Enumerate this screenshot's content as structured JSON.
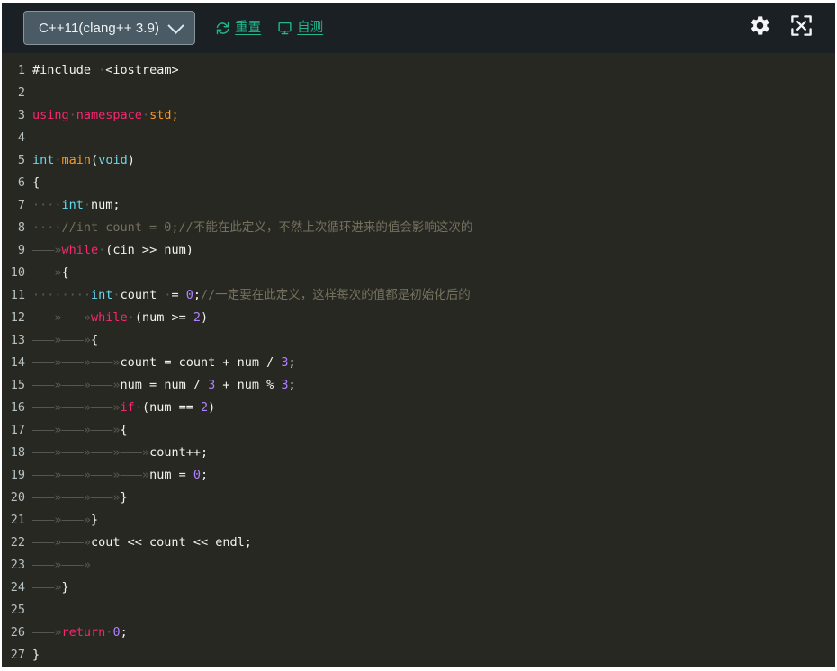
{
  "toolbar": {
    "language_selector": {
      "value": "C++11(clang++ 3.9)",
      "chevron_icon": "chevron-down-icon"
    },
    "reset_button": {
      "label": "重置",
      "icon": "refresh-icon"
    },
    "selftest_button": {
      "label": "自测",
      "icon": "monitor-icon"
    },
    "settings_button": {
      "icon": "gear-icon"
    },
    "fullscreen_button": {
      "icon": "expand-icon"
    }
  },
  "colors": {
    "toolbar_bg": "#1b2024",
    "editor_bg": "#272822",
    "accent_teal": "#22b58c",
    "select_bg": "#4a5b66",
    "gutter_text": "#b7c2c4",
    "keyword": "#f92672",
    "type": "#66d9ef",
    "function": "#fd971f",
    "number": "#ae81ff",
    "comment": "#75715e",
    "plain": "#f2f2ee",
    "whitespace_marker": "#5a5a50"
  },
  "editor": {
    "language": "cpp",
    "total_lines": 27,
    "lines": [
      {
        "n": 1,
        "tokens": [
          {
            "t": "plain",
            "v": "#include "
          },
          {
            "t": "ws",
            "v": "·"
          },
          {
            "t": "plain",
            "v": "<iostream>"
          }
        ]
      },
      {
        "n": 2,
        "tokens": []
      },
      {
        "n": 3,
        "tokens": [
          {
            "t": "kw",
            "v": "using"
          },
          {
            "t": "ws",
            "v": "·"
          },
          {
            "t": "kw",
            "v": "namespace"
          },
          {
            "t": "ws",
            "v": "·"
          },
          {
            "t": "fn",
            "v": "std"
          },
          {
            "t": "fn",
            "v": ";"
          }
        ]
      },
      {
        "n": 4,
        "tokens": []
      },
      {
        "n": 5,
        "tokens": [
          {
            "t": "type",
            "v": "int"
          },
          {
            "t": "ws",
            "v": "·"
          },
          {
            "t": "fn",
            "v": "main"
          },
          {
            "t": "plain",
            "v": "("
          },
          {
            "t": "type",
            "v": "void"
          },
          {
            "t": "plain",
            "v": ")"
          }
        ]
      },
      {
        "n": 6,
        "tokens": [
          {
            "t": "plain",
            "v": "{"
          }
        ]
      },
      {
        "n": 7,
        "tokens": [
          {
            "t": "ws",
            "v": "····"
          },
          {
            "t": "type",
            "v": "int"
          },
          {
            "t": "ws",
            "v": "·"
          },
          {
            "t": "plain",
            "v": "num;"
          }
        ]
      },
      {
        "n": 8,
        "tokens": [
          {
            "t": "ws",
            "v": "····"
          },
          {
            "t": "com",
            "v": "//int count = 0;//不能在此定义，不然上次循环进来的值会影响这次的"
          }
        ]
      },
      {
        "n": 9,
        "tokens": [
          {
            "t": "tab",
            "v": "1"
          },
          {
            "t": "kw",
            "v": "while"
          },
          {
            "t": "ws",
            "v": "·"
          },
          {
            "t": "plain",
            "v": "(cin >> num)"
          }
        ]
      },
      {
        "n": 10,
        "tokens": [
          {
            "t": "tab",
            "v": "1"
          },
          {
            "t": "plain",
            "v": "{"
          }
        ]
      },
      {
        "n": 11,
        "tokens": [
          {
            "t": "ws",
            "v": "········"
          },
          {
            "t": "type",
            "v": "int"
          },
          {
            "t": "ws",
            "v": "·"
          },
          {
            "t": "plain",
            "v": "count "
          },
          {
            "t": "ws",
            "v": "·"
          },
          {
            "t": "plain",
            "v": "= "
          },
          {
            "t": "num",
            "v": "0"
          },
          {
            "t": "plain",
            "v": ";"
          },
          {
            "t": "com",
            "v": "//一定要在此定义，这样每次的值都是初始化后的"
          }
        ]
      },
      {
        "n": 12,
        "tokens": [
          {
            "t": "tab",
            "v": "2"
          },
          {
            "t": "kw",
            "v": "while"
          },
          {
            "t": "ws",
            "v": "·"
          },
          {
            "t": "plain",
            "v": "(num >= "
          },
          {
            "t": "num",
            "v": "2"
          },
          {
            "t": "plain",
            "v": ")"
          }
        ]
      },
      {
        "n": 13,
        "tokens": [
          {
            "t": "tab",
            "v": "2"
          },
          {
            "t": "plain",
            "v": "{"
          }
        ]
      },
      {
        "n": 14,
        "tokens": [
          {
            "t": "tab",
            "v": "3"
          },
          {
            "t": "plain",
            "v": "count = count + num / "
          },
          {
            "t": "num",
            "v": "3"
          },
          {
            "t": "plain",
            "v": ";"
          }
        ]
      },
      {
        "n": 15,
        "tokens": [
          {
            "t": "tab",
            "v": "3"
          },
          {
            "t": "plain",
            "v": "num = num / "
          },
          {
            "t": "num",
            "v": "3"
          },
          {
            "t": "plain",
            "v": " + num % "
          },
          {
            "t": "num",
            "v": "3"
          },
          {
            "t": "plain",
            "v": ";"
          }
        ]
      },
      {
        "n": 16,
        "tokens": [
          {
            "t": "tab",
            "v": "3"
          },
          {
            "t": "kw",
            "v": "if"
          },
          {
            "t": "ws",
            "v": "·"
          },
          {
            "t": "plain",
            "v": "(num == "
          },
          {
            "t": "num",
            "v": "2"
          },
          {
            "t": "plain",
            "v": ")"
          }
        ]
      },
      {
        "n": 17,
        "tokens": [
          {
            "t": "tab",
            "v": "3"
          },
          {
            "t": "plain",
            "v": "{"
          }
        ]
      },
      {
        "n": 18,
        "tokens": [
          {
            "t": "tab",
            "v": "4"
          },
          {
            "t": "plain",
            "v": "count++;"
          }
        ]
      },
      {
        "n": 19,
        "tokens": [
          {
            "t": "tab",
            "v": "4"
          },
          {
            "t": "plain",
            "v": "num = "
          },
          {
            "t": "num",
            "v": "0"
          },
          {
            "t": "plain",
            "v": ";"
          }
        ]
      },
      {
        "n": 20,
        "tokens": [
          {
            "t": "tab",
            "v": "3"
          },
          {
            "t": "plain",
            "v": "}"
          }
        ]
      },
      {
        "n": 21,
        "tokens": [
          {
            "t": "tab",
            "v": "2"
          },
          {
            "t": "plain",
            "v": "}"
          }
        ]
      },
      {
        "n": 22,
        "tokens": [
          {
            "t": "tab",
            "v": "2"
          },
          {
            "t": "plain",
            "v": "cout << count << endl;"
          }
        ]
      },
      {
        "n": 23,
        "tokens": [
          {
            "t": "tab",
            "v": "2"
          }
        ]
      },
      {
        "n": 24,
        "tokens": [
          {
            "t": "tab",
            "v": "1"
          },
          {
            "t": "plain",
            "v": "}"
          }
        ]
      },
      {
        "n": 25,
        "tokens": []
      },
      {
        "n": 26,
        "tokens": [
          {
            "t": "tab",
            "v": "1"
          },
          {
            "t": "kw",
            "v": "return"
          },
          {
            "t": "ws",
            "v": "·"
          },
          {
            "t": "num",
            "v": "0"
          },
          {
            "t": "plain",
            "v": ";"
          }
        ]
      },
      {
        "n": 27,
        "tokens": [
          {
            "t": "plain",
            "v": "}"
          }
        ]
      }
    ]
  }
}
